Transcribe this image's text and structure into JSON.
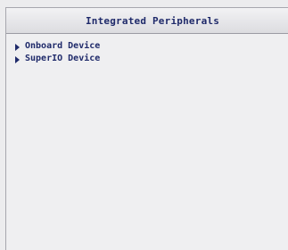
{
  "page": {
    "title": "Integrated Peripherals"
  },
  "menu": {
    "items": [
      {
        "label": "Onboard Device"
      },
      {
        "label": "SuperIO Device"
      }
    ]
  },
  "colors": {
    "text": "#1f2a6a",
    "background": "#ececee",
    "border": "#a7a7ae"
  },
  "icons": {
    "submenu": "right-triangle-icon"
  }
}
